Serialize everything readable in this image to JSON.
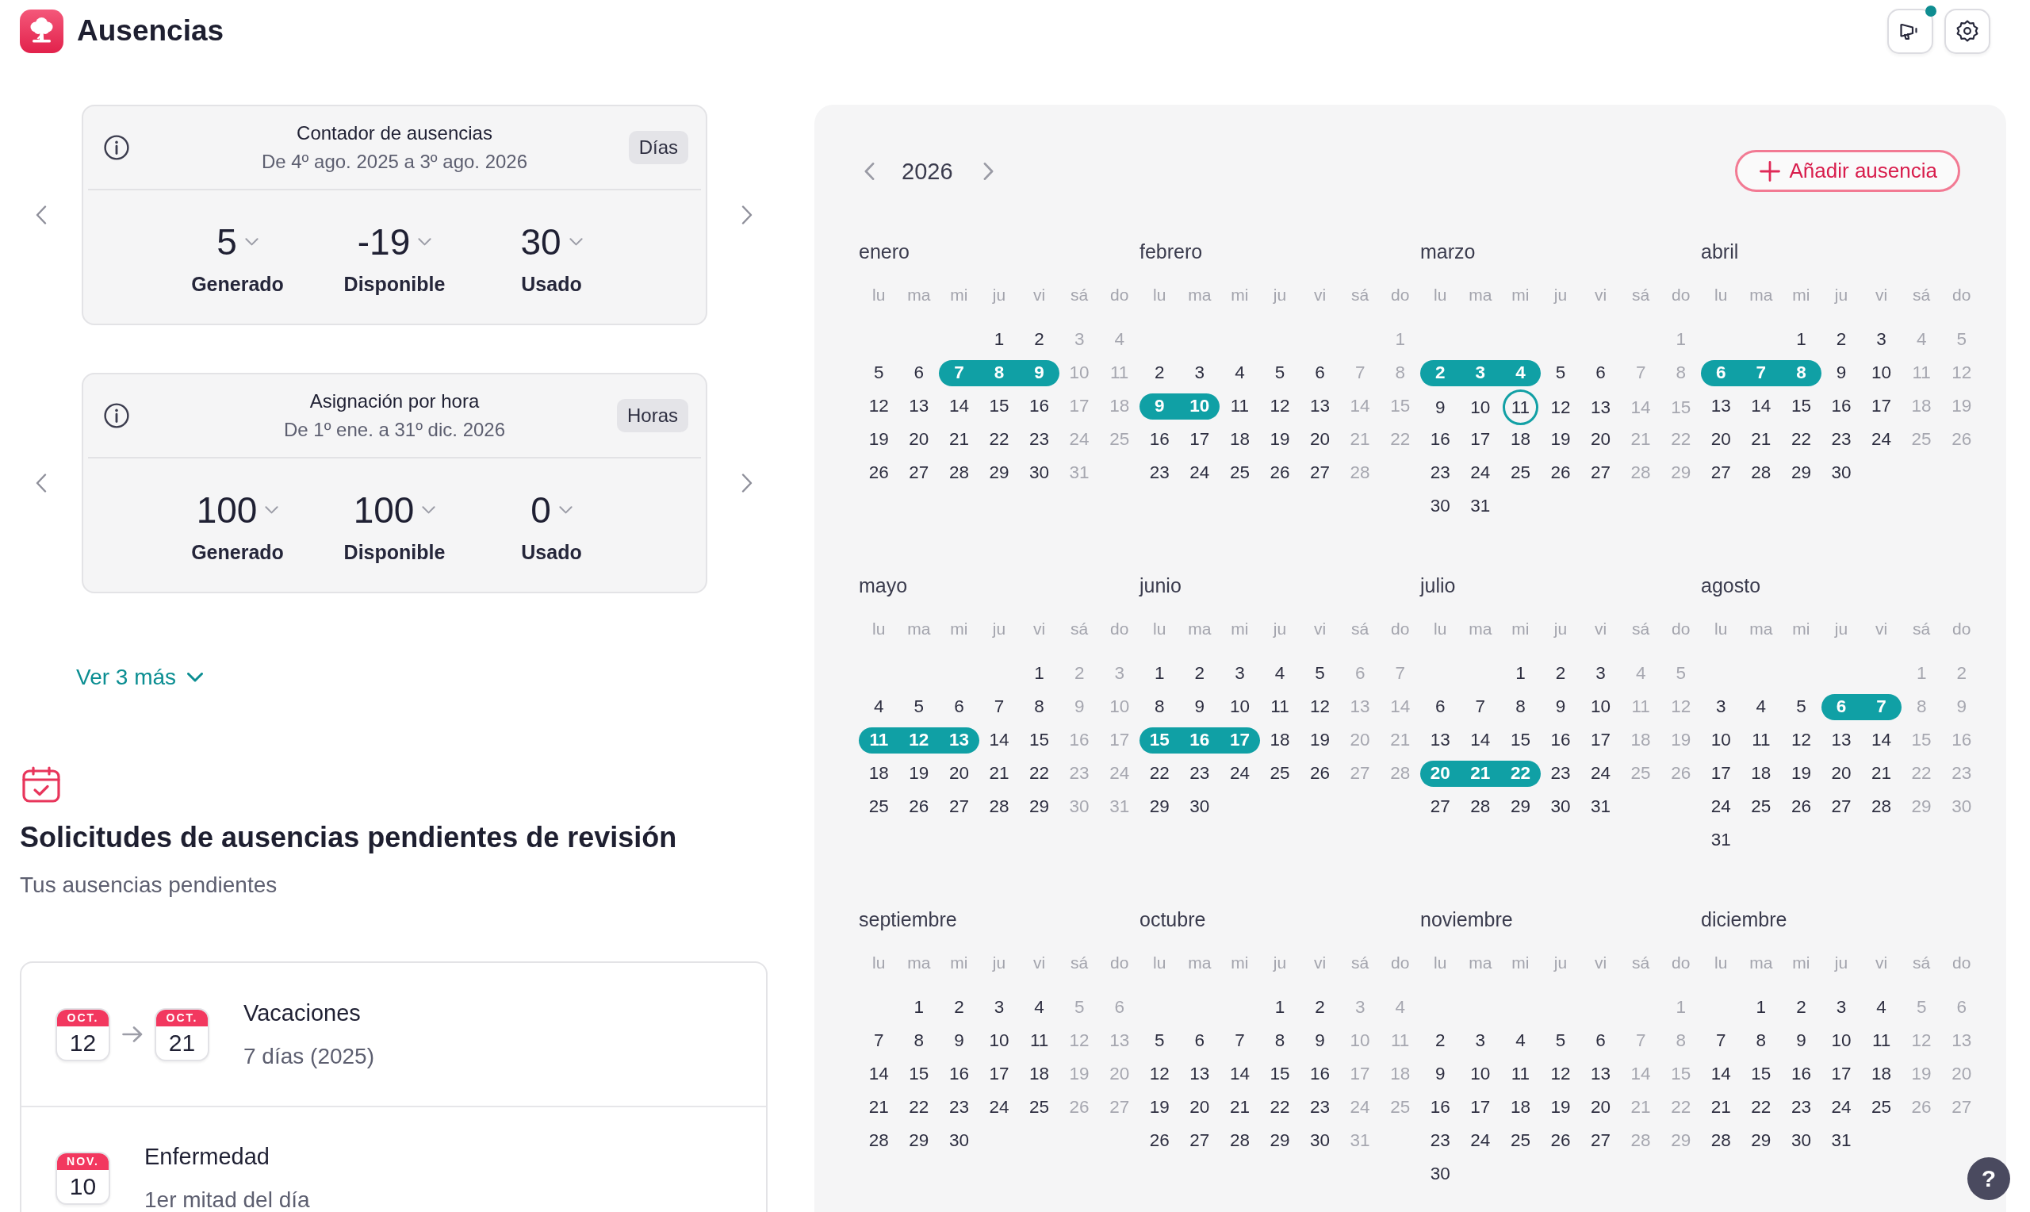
{
  "header": {
    "title": "Ausencias",
    "announcements": {
      "unread": true
    }
  },
  "counters": [
    {
      "title": "Contador de ausencias",
      "period": "De 4º ago. 2025 a 3º ago. 2026",
      "unit": "Días",
      "stats": [
        {
          "value": "5",
          "label": "Generado"
        },
        {
          "value": "-19",
          "label": "Disponible"
        },
        {
          "value": "30",
          "label": "Usado"
        }
      ]
    },
    {
      "title": "Asignación por hora",
      "period": "De 1º ene. a 31º dic. 2026",
      "unit": "Horas",
      "stats": [
        {
          "value": "100",
          "label": "Generado"
        },
        {
          "value": "100",
          "label": "Disponible"
        },
        {
          "value": "0",
          "label": "Usado"
        }
      ]
    }
  ],
  "show_more": "Ver 3 más",
  "pending": {
    "title": "Solicitudes de ausencias pendientes de revisión",
    "subtitle": "Tus ausencias pendientes",
    "requests": [
      {
        "type": "Vacaciones",
        "detail": "7 días (2025)",
        "dates": [
          {
            "month": "OCT.",
            "day": "12"
          },
          {
            "month": "OCT.",
            "day": "21"
          }
        ]
      },
      {
        "type": "Enfermedad",
        "detail": "1er mitad del día",
        "dates": [
          {
            "month": "NOV.",
            "day": "10"
          }
        ]
      }
    ]
  },
  "calendar": {
    "year": "2026",
    "add_button": "Añadir ausencia",
    "months": [
      {
        "name": "enero",
        "weekdays": [
          "lu",
          "ma",
          "mi",
          "ju",
          "vi",
          "sá",
          "do"
        ],
        "weeks": [
          [
            {
              "day": "1",
              "kind": "work"
            },
            {
              "day": "2",
              "kind": "work"
            },
            {
              "day": "3",
              "kind": "weekend"
            },
            {
              "day": "4",
              "kind": "weekend"
            }
          ],
          [
            {
              "day": "5",
              "kind": "work"
            },
            {
              "day": "6",
              "kind": "work"
            },
            {
              "day": "7",
              "kind": "absence"
            },
            {
              "day": "8",
              "kind": "absence"
            },
            {
              "day": "9",
              "kind": "absence"
            },
            {
              "day": "10",
              "kind": "weekend"
            },
            {
              "day": "11",
              "kind": "weekend"
            }
          ],
          [
            {
              "day": "12",
              "kind": "work"
            },
            {
              "day": "13",
              "kind": "work"
            },
            {
              "day": "14",
              "kind": "work"
            },
            {
              "day": "15",
              "kind": "work"
            },
            {
              "day": "16",
              "kind": "work"
            },
            {
              "day": "17",
              "kind": "weekend"
            },
            {
              "day": "18",
              "kind": "weekend"
            }
          ],
          [
            {
              "day": "19",
              "kind": "work"
            },
            {
              "day": "20",
              "kind": "work"
            },
            {
              "day": "21",
              "kind": "work"
            },
            {
              "day": "22",
              "kind": "work"
            },
            {
              "day": "23",
              "kind": "work"
            },
            {
              "day": "24",
              "kind": "weekend"
            },
            {
              "day": "25",
              "kind": "weekend"
            }
          ],
          [
            {
              "day": "26",
              "kind": "work"
            },
            {
              "day": "27",
              "kind": "work"
            },
            {
              "day": "28",
              "kind": "work"
            },
            {
              "day": "29",
              "kind": "work"
            },
            {
              "day": "30",
              "kind": "work"
            },
            {
              "day": "31",
              "kind": "weekend"
            }
          ]
        ]
      },
      {
        "name": "febrero",
        "weekdays": [
          "lu",
          "ma",
          "mi",
          "ju",
          "vi",
          "sá",
          "do"
        ],
        "weeks": [
          [
            {
              "day": "1",
              "kind": "weekend"
            }
          ],
          [
            {
              "day": "2",
              "kind": "work"
            },
            {
              "day": "3",
              "kind": "work"
            },
            {
              "day": "4",
              "kind": "work"
            },
            {
              "day": "5",
              "kind": "work"
            },
            {
              "day": "6",
              "kind": "work"
            },
            {
              "day": "7",
              "kind": "weekend"
            },
            {
              "day": "8",
              "kind": "weekend"
            }
          ],
          [
            {
              "day": "9",
              "kind": "absence"
            },
            {
              "day": "10",
              "kind": "absence"
            },
            {
              "day": "11",
              "kind": "work"
            },
            {
              "day": "12",
              "kind": "work"
            },
            {
              "day": "13",
              "kind": "work"
            },
            {
              "day": "14",
              "kind": "weekend"
            },
            {
              "day": "15",
              "kind": "weekend"
            }
          ],
          [
            {
              "day": "16",
              "kind": "work"
            },
            {
              "day": "17",
              "kind": "work"
            },
            {
              "day": "18",
              "kind": "work"
            },
            {
              "day": "19",
              "kind": "work"
            },
            {
              "day": "20",
              "kind": "work"
            },
            {
              "day": "21",
              "kind": "weekend"
            },
            {
              "day": "22",
              "kind": "weekend"
            }
          ],
          [
            {
              "day": "23",
              "kind": "work"
            },
            {
              "day": "24",
              "kind": "work"
            },
            {
              "day": "25",
              "kind": "work"
            },
            {
              "day": "26",
              "kind": "work"
            },
            {
              "day": "27",
              "kind": "work"
            },
            {
              "day": "28",
              "kind": "weekend"
            }
          ]
        ]
      },
      {
        "name": "marzo",
        "weekdays": [
          "lu",
          "ma",
          "mi",
          "ju",
          "vi",
          "sá",
          "do"
        ],
        "weeks": [
          [
            {
              "day": "1",
              "kind": "weekend"
            }
          ],
          [
            {
              "day": "2",
              "kind": "absence"
            },
            {
              "day": "3",
              "kind": "absence"
            },
            {
              "day": "4",
              "kind": "absence"
            },
            {
              "day": "5",
              "kind": "work"
            },
            {
              "day": "6",
              "kind": "work"
            },
            {
              "day": "7",
              "kind": "weekend"
            },
            {
              "day": "8",
              "kind": "weekend"
            }
          ],
          [
            {
              "day": "9",
              "kind": "work"
            },
            {
              "day": "10",
              "kind": "work"
            },
            {
              "day": "11",
              "kind": "today"
            },
            {
              "day": "12",
              "kind": "work"
            },
            {
              "day": "13",
              "kind": "work"
            },
            {
              "day": "14",
              "kind": "weekend"
            },
            {
              "day": "15",
              "kind": "weekend"
            }
          ],
          [
            {
              "day": "16",
              "kind": "work"
            },
            {
              "day": "17",
              "kind": "work"
            },
            {
              "day": "18",
              "kind": "work"
            },
            {
              "day": "19",
              "kind": "work"
            },
            {
              "day": "20",
              "kind": "work"
            },
            {
              "day": "21",
              "kind": "weekend"
            },
            {
              "day": "22",
              "kind": "weekend"
            }
          ],
          [
            {
              "day": "23",
              "kind": "work"
            },
            {
              "day": "24",
              "kind": "work"
            },
            {
              "day": "25",
              "kind": "work"
            },
            {
              "day": "26",
              "kind": "work"
            },
            {
              "day": "27",
              "kind": "work"
            },
            {
              "day": "28",
              "kind": "weekend"
            },
            {
              "day": "29",
              "kind": "weekend"
            }
          ],
          [
            {
              "day": "30",
              "kind": "work"
            },
            {
              "day": "31",
              "kind": "work"
            }
          ]
        ]
      },
      {
        "name": "abril",
        "weekdays": [
          "lu",
          "ma",
          "mi",
          "ju",
          "vi",
          "sá",
          "do"
        ],
        "weeks": [
          [
            {
              "day": "1",
              "kind": "work"
            },
            {
              "day": "2",
              "kind": "work"
            },
            {
              "day": "3",
              "kind": "work"
            },
            {
              "day": "4",
              "kind": "weekend"
            },
            {
              "day": "5",
              "kind": "weekend"
            }
          ],
          [
            {
              "day": "6",
              "kind": "absence"
            },
            {
              "day": "7",
              "kind": "absence"
            },
            {
              "day": "8",
              "kind": "absence"
            },
            {
              "day": "9",
              "kind": "work"
            },
            {
              "day": "10",
              "kind": "work"
            },
            {
              "day": "11",
              "kind": "weekend"
            },
            {
              "day": "12",
              "kind": "weekend"
            }
          ],
          [
            {
              "day": "13",
              "kind": "work"
            },
            {
              "day": "14",
              "kind": "work"
            },
            {
              "day": "15",
              "kind": "work"
            },
            {
              "day": "16",
              "kind": "work"
            },
            {
              "day": "17",
              "kind": "work"
            },
            {
              "day": "18",
              "kind": "weekend"
            },
            {
              "day": "19",
              "kind": "weekend"
            }
          ],
          [
            {
              "day": "20",
              "kind": "work"
            },
            {
              "day": "21",
              "kind": "work"
            },
            {
              "day": "22",
              "kind": "work"
            },
            {
              "day": "23",
              "kind": "work"
            },
            {
              "day": "24",
              "kind": "work"
            },
            {
              "day": "25",
              "kind": "weekend"
            },
            {
              "day": "26",
              "kind": "weekend"
            }
          ],
          [
            {
              "day": "27",
              "kind": "work"
            },
            {
              "day": "28",
              "kind": "work"
            },
            {
              "day": "29",
              "kind": "work"
            },
            {
              "day": "30",
              "kind": "work"
            }
          ]
        ]
      },
      {
        "name": "mayo",
        "weekdays": [
          "lu",
          "ma",
          "mi",
          "ju",
          "vi",
          "sá",
          "do"
        ],
        "weeks": [
          [
            {
              "day": "1",
              "kind": "work"
            },
            {
              "day": "2",
              "kind": "weekend"
            },
            {
              "day": "3",
              "kind": "weekend"
            }
          ],
          [
            {
              "day": "4",
              "kind": "work"
            },
            {
              "day": "5",
              "kind": "work"
            },
            {
              "day": "6",
              "kind": "work"
            },
            {
              "day": "7",
              "kind": "work"
            },
            {
              "day": "8",
              "kind": "work"
            },
            {
              "day": "9",
              "kind": "weekend"
            },
            {
              "day": "10",
              "kind": "weekend"
            }
          ],
          [
            {
              "day": "11",
              "kind": "absence"
            },
            {
              "day": "12",
              "kind": "absence"
            },
            {
              "day": "13",
              "kind": "absence"
            },
            {
              "day": "14",
              "kind": "work"
            },
            {
              "day": "15",
              "kind": "work"
            },
            {
              "day": "16",
              "kind": "weekend"
            },
            {
              "day": "17",
              "kind": "weekend"
            }
          ],
          [
            {
              "day": "18",
              "kind": "work"
            },
            {
              "day": "19",
              "kind": "work"
            },
            {
              "day": "20",
              "kind": "work"
            },
            {
              "day": "21",
              "kind": "work"
            },
            {
              "day": "22",
              "kind": "work"
            },
            {
              "day": "23",
              "kind": "weekend"
            },
            {
              "day": "24",
              "kind": "weekend"
            }
          ],
          [
            {
              "day": "25",
              "kind": "work"
            },
            {
              "day": "26",
              "kind": "work"
            },
            {
              "day": "27",
              "kind": "work"
            },
            {
              "day": "28",
              "kind": "work"
            },
            {
              "day": "29",
              "kind": "work"
            },
            {
              "day": "30",
              "kind": "weekend"
            },
            {
              "day": "31",
              "kind": "weekend"
            }
          ]
        ]
      },
      {
        "name": "junio",
        "weekdays": [
          "lu",
          "ma",
          "mi",
          "ju",
          "vi",
          "sá",
          "do"
        ],
        "weeks": [
          [
            {
              "day": "1",
              "kind": "work"
            },
            {
              "day": "2",
              "kind": "work"
            },
            {
              "day": "3",
              "kind": "work"
            },
            {
              "day": "4",
              "kind": "work"
            },
            {
              "day": "5",
              "kind": "work"
            },
            {
              "day": "6",
              "kind": "weekend"
            },
            {
              "day": "7",
              "kind": "weekend"
            }
          ],
          [
            {
              "day": "8",
              "kind": "work"
            },
            {
              "day": "9",
              "kind": "work"
            },
            {
              "day": "10",
              "kind": "work"
            },
            {
              "day": "11",
              "kind": "work"
            },
            {
              "day": "12",
              "kind": "work"
            },
            {
              "day": "13",
              "kind": "weekend"
            },
            {
              "day": "14",
              "kind": "weekend"
            }
          ],
          [
            {
              "day": "15",
              "kind": "absence"
            },
            {
              "day": "16",
              "kind": "absence"
            },
            {
              "day": "17",
              "kind": "absence"
            },
            {
              "day": "18",
              "kind": "work"
            },
            {
              "day": "19",
              "kind": "work"
            },
            {
              "day": "20",
              "kind": "weekend"
            },
            {
              "day": "21",
              "kind": "weekend"
            }
          ],
          [
            {
              "day": "22",
              "kind": "work"
            },
            {
              "day": "23",
              "kind": "work"
            },
            {
              "day": "24",
              "kind": "work"
            },
            {
              "day": "25",
              "kind": "work"
            },
            {
              "day": "26",
              "kind": "work"
            },
            {
              "day": "27",
              "kind": "weekend"
            },
            {
              "day": "28",
              "kind": "weekend"
            }
          ],
          [
            {
              "day": "29",
              "kind": "work"
            },
            {
              "day": "30",
              "kind": "work"
            }
          ]
        ]
      },
      {
        "name": "julio",
        "weekdays": [
          "lu",
          "ma",
          "mi",
          "ju",
          "vi",
          "sá",
          "do"
        ],
        "weeks": [
          [
            {
              "day": "1",
              "kind": "work"
            },
            {
              "day": "2",
              "kind": "work"
            },
            {
              "day": "3",
              "kind": "work"
            },
            {
              "day": "4",
              "kind": "weekend"
            },
            {
              "day": "5",
              "kind": "weekend"
            }
          ],
          [
            {
              "day": "6",
              "kind": "work"
            },
            {
              "day": "7",
              "kind": "work"
            },
            {
              "day": "8",
              "kind": "work"
            },
            {
              "day": "9",
              "kind": "work"
            },
            {
              "day": "10",
              "kind": "work"
            },
            {
              "day": "11",
              "kind": "weekend"
            },
            {
              "day": "12",
              "kind": "weekend"
            }
          ],
          [
            {
              "day": "13",
              "kind": "work"
            },
            {
              "day": "14",
              "kind": "work"
            },
            {
              "day": "15",
              "kind": "work"
            },
            {
              "day": "16",
              "kind": "work"
            },
            {
              "day": "17",
              "kind": "work"
            },
            {
              "day": "18",
              "kind": "weekend"
            },
            {
              "day": "19",
              "kind": "weekend"
            }
          ],
          [
            {
              "day": "20",
              "kind": "absence"
            },
            {
              "day": "21",
              "kind": "absence"
            },
            {
              "day": "22",
              "kind": "absence"
            },
            {
              "day": "23",
              "kind": "work"
            },
            {
              "day": "24",
              "kind": "work"
            },
            {
              "day": "25",
              "kind": "weekend"
            },
            {
              "day": "26",
              "kind": "weekend"
            }
          ],
          [
            {
              "day": "27",
              "kind": "work"
            },
            {
              "day": "28",
              "kind": "work"
            },
            {
              "day": "29",
              "kind": "work"
            },
            {
              "day": "30",
              "kind": "work"
            },
            {
              "day": "31",
              "kind": "work"
            }
          ]
        ]
      },
      {
        "name": "agosto",
        "weekdays": [
          "lu",
          "ma",
          "mi",
          "ju",
          "vi",
          "sá",
          "do"
        ],
        "weeks": [
          [
            {
              "day": "1",
              "kind": "weekend"
            },
            {
              "day": "2",
              "kind": "weekend"
            }
          ],
          [
            {
              "day": "3",
              "kind": "work"
            },
            {
              "day": "4",
              "kind": "work"
            },
            {
              "day": "5",
              "kind": "work"
            },
            {
              "day": "6",
              "kind": "absence"
            },
            {
              "day": "7",
              "kind": "absence"
            },
            {
              "day": "8",
              "kind": "weekend"
            },
            {
              "day": "9",
              "kind": "weekend"
            }
          ],
          [
            {
              "day": "10",
              "kind": "work"
            },
            {
              "day": "11",
              "kind": "work"
            },
            {
              "day": "12",
              "kind": "work"
            },
            {
              "day": "13",
              "kind": "work"
            },
            {
              "day": "14",
              "kind": "work"
            },
            {
              "day": "15",
              "kind": "weekend"
            },
            {
              "day": "16",
              "kind": "weekend"
            }
          ],
          [
            {
              "day": "17",
              "kind": "work"
            },
            {
              "day": "18",
              "kind": "work"
            },
            {
              "day": "19",
              "kind": "work"
            },
            {
              "day": "20",
              "kind": "work"
            },
            {
              "day": "21",
              "kind": "work"
            },
            {
              "day": "22",
              "kind": "weekend"
            },
            {
              "day": "23",
              "kind": "weekend"
            }
          ],
          [
            {
              "day": "24",
              "kind": "work"
            },
            {
              "day": "25",
              "kind": "work"
            },
            {
              "day": "26",
              "kind": "work"
            },
            {
              "day": "27",
              "kind": "work"
            },
            {
              "day": "28",
              "kind": "work"
            },
            {
              "day": "29",
              "kind": "weekend"
            },
            {
              "day": "30",
              "kind": "weekend"
            }
          ],
          [
            {
              "day": "31",
              "kind": "work"
            }
          ]
        ]
      },
      {
        "name": "septiembre",
        "weekdays": [
          "lu",
          "ma",
          "mi",
          "ju",
          "vi",
          "sá",
          "do"
        ],
        "weeks": [
          [
            {
              "day": "1",
              "kind": "work"
            },
            {
              "day": "2",
              "kind": "work"
            },
            {
              "day": "3",
              "kind": "work"
            },
            {
              "day": "4",
              "kind": "work"
            },
            {
              "day": "5",
              "kind": "weekend"
            },
            {
              "day": "6",
              "kind": "weekend"
            }
          ],
          [
            {
              "day": "7",
              "kind": "work"
            },
            {
              "day": "8",
              "kind": "work"
            },
            {
              "day": "9",
              "kind": "work"
            },
            {
              "day": "10",
              "kind": "work"
            },
            {
              "day": "11",
              "kind": "work"
            },
            {
              "day": "12",
              "kind": "weekend"
            },
            {
              "day": "13",
              "kind": "weekend"
            }
          ],
          [
            {
              "day": "14",
              "kind": "work"
            },
            {
              "day": "15",
              "kind": "work"
            },
            {
              "day": "16",
              "kind": "work"
            },
            {
              "day": "17",
              "kind": "work"
            },
            {
              "day": "18",
              "kind": "work"
            },
            {
              "day": "19",
              "kind": "weekend"
            },
            {
              "day": "20",
              "kind": "weekend"
            }
          ],
          [
            {
              "day": "21",
              "kind": "work"
            },
            {
              "day": "22",
              "kind": "work"
            },
            {
              "day": "23",
              "kind": "work"
            },
            {
              "day": "24",
              "kind": "work"
            },
            {
              "day": "25",
              "kind": "work"
            },
            {
              "day": "26",
              "kind": "weekend"
            },
            {
              "day": "27",
              "kind": "weekend"
            }
          ],
          [
            {
              "day": "28",
              "kind": "work"
            },
            {
              "day": "29",
              "kind": "work"
            },
            {
              "day": "30",
              "kind": "work"
            }
          ]
        ]
      },
      {
        "name": "octubre",
        "weekdays": [
          "lu",
          "ma",
          "mi",
          "ju",
          "vi",
          "sá",
          "do"
        ],
        "weeks": [
          [
            {
              "day": "1",
              "kind": "work"
            },
            {
              "day": "2",
              "kind": "work"
            },
            {
              "day": "3",
              "kind": "weekend"
            },
            {
              "day": "4",
              "kind": "weekend"
            }
          ],
          [
            {
              "day": "5",
              "kind": "work"
            },
            {
              "day": "6",
              "kind": "work"
            },
            {
              "day": "7",
              "kind": "work"
            },
            {
              "day": "8",
              "kind": "work"
            },
            {
              "day": "9",
              "kind": "work"
            },
            {
              "day": "10",
              "kind": "weekend"
            },
            {
              "day": "11",
              "kind": "weekend"
            }
          ],
          [
            {
              "day": "12",
              "kind": "work"
            },
            {
              "day": "13",
              "kind": "work"
            },
            {
              "day": "14",
              "kind": "work"
            },
            {
              "day": "15",
              "kind": "work"
            },
            {
              "day": "16",
              "kind": "work"
            },
            {
              "day": "17",
              "kind": "weekend"
            },
            {
              "day": "18",
              "kind": "weekend"
            }
          ],
          [
            {
              "day": "19",
              "kind": "work"
            },
            {
              "day": "20",
              "kind": "work"
            },
            {
              "day": "21",
              "kind": "work"
            },
            {
              "day": "22",
              "kind": "work"
            },
            {
              "day": "23",
              "kind": "work"
            },
            {
              "day": "24",
              "kind": "weekend"
            },
            {
              "day": "25",
              "kind": "weekend"
            }
          ],
          [
            {
              "day": "26",
              "kind": "work"
            },
            {
              "day": "27",
              "kind": "work"
            },
            {
              "day": "28",
              "kind": "work"
            },
            {
              "day": "29",
              "kind": "work"
            },
            {
              "day": "30",
              "kind": "work"
            },
            {
              "day": "31",
              "kind": "weekend"
            }
          ]
        ]
      },
      {
        "name": "noviembre",
        "weekdays": [
          "lu",
          "ma",
          "mi",
          "ju",
          "vi",
          "sá",
          "do"
        ],
        "weeks": [
          [
            {
              "day": "1",
              "kind": "weekend"
            }
          ],
          [
            {
              "day": "2",
              "kind": "work"
            },
            {
              "day": "3",
              "kind": "work"
            },
            {
              "day": "4",
              "kind": "work"
            },
            {
              "day": "5",
              "kind": "work"
            },
            {
              "day": "6",
              "kind": "work"
            },
            {
              "day": "7",
              "kind": "weekend"
            },
            {
              "day": "8",
              "kind": "weekend"
            }
          ],
          [
            {
              "day": "9",
              "kind": "work"
            },
            {
              "day": "10",
              "kind": "work"
            },
            {
              "day": "11",
              "kind": "work"
            },
            {
              "day": "12",
              "kind": "work"
            },
            {
              "day": "13",
              "kind": "work"
            },
            {
              "day": "14",
              "kind": "weekend"
            },
            {
              "day": "15",
              "kind": "weekend"
            }
          ],
          [
            {
              "day": "16",
              "kind": "work"
            },
            {
              "day": "17",
              "kind": "work"
            },
            {
              "day": "18",
              "kind": "work"
            },
            {
              "day": "19",
              "kind": "work"
            },
            {
              "day": "20",
              "kind": "work"
            },
            {
              "day": "21",
              "kind": "weekend"
            },
            {
              "day": "22",
              "kind": "weekend"
            }
          ],
          [
            {
              "day": "23",
              "kind": "work"
            },
            {
              "day": "24",
              "kind": "work"
            },
            {
              "day": "25",
              "kind": "work"
            },
            {
              "day": "26",
              "kind": "work"
            },
            {
              "day": "27",
              "kind": "work"
            },
            {
              "day": "28",
              "kind": "weekend"
            },
            {
              "day": "29",
              "kind": "weekend"
            }
          ],
          [
            {
              "day": "30",
              "kind": "work"
            }
          ]
        ]
      },
      {
        "name": "diciembre",
        "weekdays": [
          "lu",
          "ma",
          "mi",
          "ju",
          "vi",
          "sá",
          "do"
        ],
        "weeks": [
          [
            {
              "day": "1",
              "kind": "work"
            },
            {
              "day": "2",
              "kind": "work"
            },
            {
              "day": "3",
              "kind": "work"
            },
            {
              "day": "4",
              "kind": "work"
            },
            {
              "day": "5",
              "kind": "weekend"
            },
            {
              "day": "6",
              "kind": "weekend"
            }
          ],
          [
            {
              "day": "7",
              "kind": "work"
            },
            {
              "day": "8",
              "kind": "work"
            },
            {
              "day": "9",
              "kind": "work"
            },
            {
              "day": "10",
              "kind": "work"
            },
            {
              "day": "11",
              "kind": "work"
            },
            {
              "day": "12",
              "kind": "weekend"
            },
            {
              "day": "13",
              "kind": "weekend"
            }
          ],
          [
            {
              "day": "14",
              "kind": "work"
            },
            {
              "day": "15",
              "kind": "work"
            },
            {
              "day": "16",
              "kind": "work"
            },
            {
              "day": "17",
              "kind": "work"
            },
            {
              "day": "18",
              "kind": "work"
            },
            {
              "day": "19",
              "kind": "weekend"
            },
            {
              "day": "20",
              "kind": "weekend"
            }
          ],
          [
            {
              "day": "21",
              "kind": "work"
            },
            {
              "day": "22",
              "kind": "work"
            },
            {
              "day": "23",
              "kind": "work"
            },
            {
              "day": "24",
              "kind": "work"
            },
            {
              "day": "25",
              "kind": "work"
            },
            {
              "day": "26",
              "kind": "weekend"
            },
            {
              "day": "27",
              "kind": "weekend"
            }
          ],
          [
            {
              "day": "28",
              "kind": "work"
            },
            {
              "day": "29",
              "kind": "work"
            },
            {
              "day": "30",
              "kind": "work"
            },
            {
              "day": "31",
              "kind": "work"
            }
          ]
        ]
      }
    ]
  },
  "help_button": "?"
}
